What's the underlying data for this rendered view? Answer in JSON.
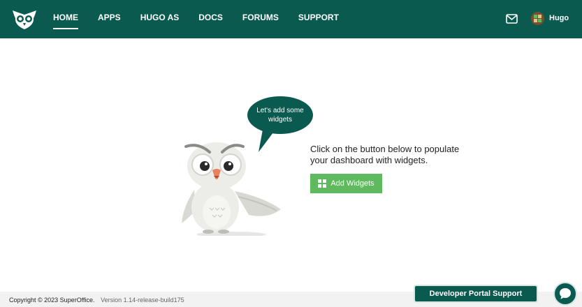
{
  "nav": {
    "items": [
      {
        "label": "HOME",
        "active": true
      },
      {
        "label": "APPS"
      },
      {
        "label": "HUGO AS"
      },
      {
        "label": "DOCS"
      },
      {
        "label": "FORUMS"
      },
      {
        "label": "SUPPORT"
      }
    ]
  },
  "user": {
    "name": "Hugo"
  },
  "main": {
    "bubble_text": "Let's add some widgets",
    "message": "Click on the button below to populate your dashboard with widgets.",
    "add_widgets_label": "Add Widgets"
  },
  "footer": {
    "copyright": "Copyright © 2023 SuperOffice.",
    "version": "Version 1.14-release-build175"
  },
  "support": {
    "label": "Developer Portal Support"
  },
  "colors": {
    "brand": "#0b5a4f",
    "accent": "#5fba5f"
  },
  "icons": [
    "owl-logo-icon",
    "mail-icon",
    "avatar-icon",
    "grid-icon",
    "chat-icon"
  ]
}
